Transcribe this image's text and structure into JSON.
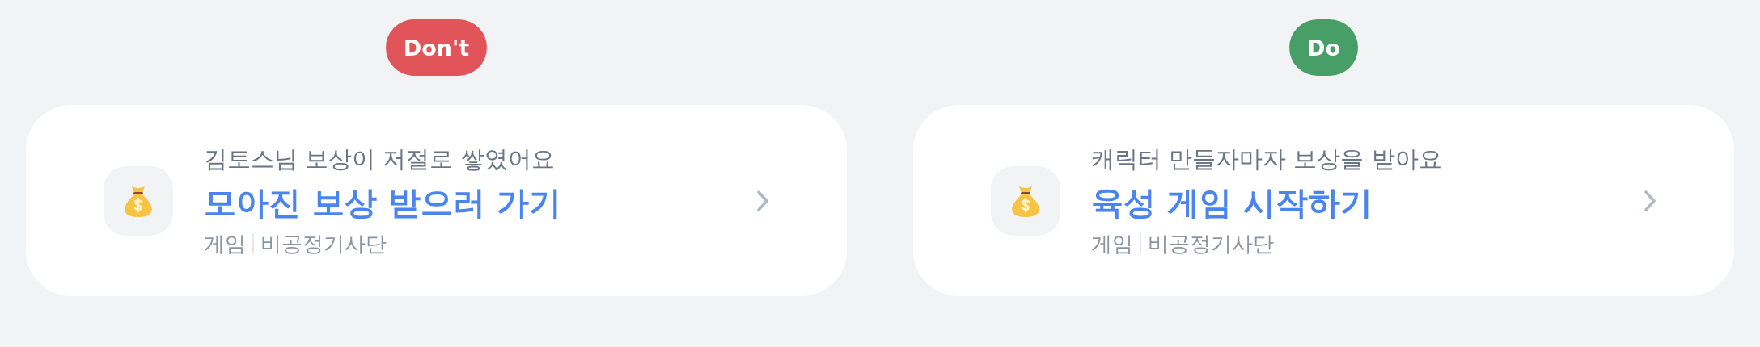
{
  "examples": [
    {
      "kind": "dont",
      "badge": "Don't",
      "card": {
        "subtitle": "김토스님 보상이 저절로 쌓였어요",
        "title": "모아진 보상 받으러 가기",
        "category": "게임",
        "source": "비공정기사단"
      }
    },
    {
      "kind": "do",
      "badge": "Do",
      "card": {
        "subtitle": "캐릭터 만들자마자 보상을 받아요",
        "title": "육성 게임 시작하기",
        "category": "게임",
        "source": "비공정기사단"
      }
    }
  ]
}
